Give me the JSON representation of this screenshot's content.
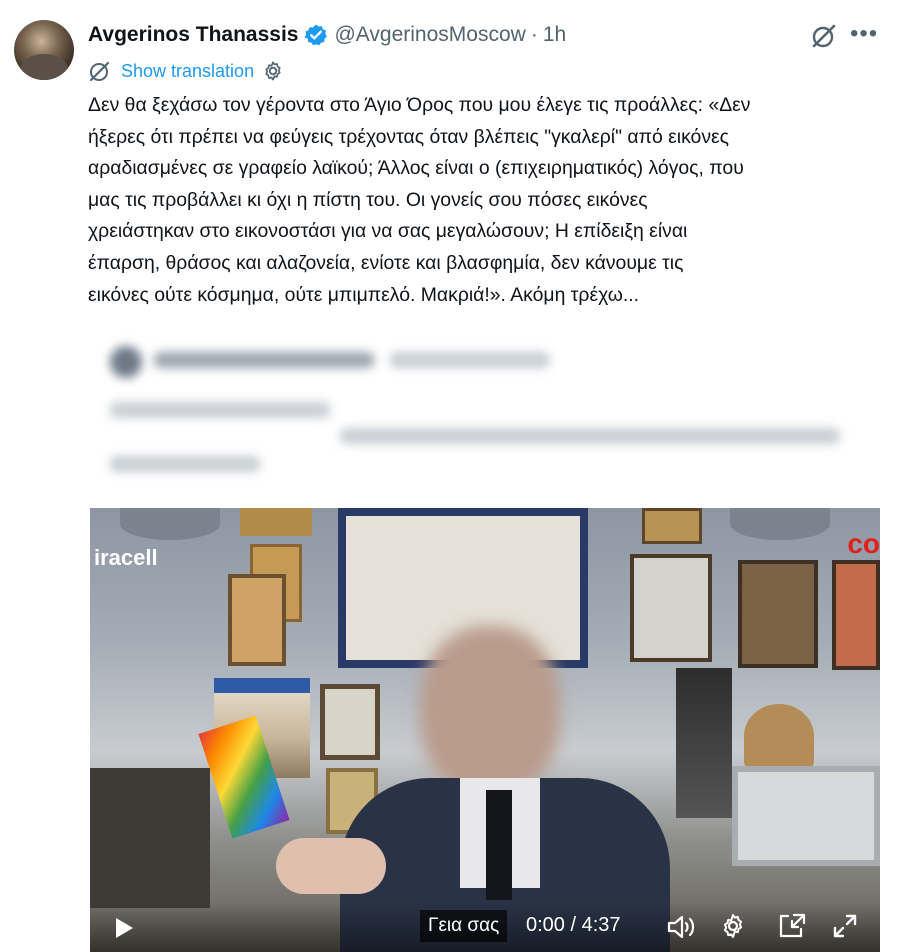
{
  "author": {
    "name": "Avgerinos Thanassis",
    "handle": "@AvgerinosMoscow",
    "separator": "·",
    "time": "1h"
  },
  "translation": {
    "label": "Show translation"
  },
  "tweet": {
    "lines": [
      "Δεν θα ξεχάσω τον γέροντα στο Άγιο Όρος που μου έλεγε τις προάλλες: «Δεν",
      "ήξερες ότι πρέπει να φεύγεις τρέχοντας όταν βλέπεις \"γκαλερί\" από εικόνες",
      "αραδιασμένες σε γραφείο λαϊκού; Άλλος είναι ο (επιχειρηματικός) λόγος, που",
      "μας τις προβάλλει κι όχι η πίστη του. Οι γονείς σου πόσες εικόνες",
      "χρειάστηκαν στο εικονοστάσι για να σας μεγαλώσουν; Η επίδειξη είναι",
      "έπαρση, θράσος και αλαζονεία, ενίοτε και βλασφημία, δεν κάνουμε τις",
      "εικόνες ούτε κόσμημα, ούτε μπιμπελό. Μακριά!». Ακόμη τρέχω..."
    ]
  },
  "video": {
    "brand_left": "iracell",
    "brand_right": "co",
    "caption": "Γεια σας",
    "timecode": "0:00 / 4:37"
  },
  "icons": {
    "verified": "verified-badge-icon",
    "grok": "grok-icon",
    "more": "more-icon",
    "translate": "translate-icon",
    "settings": "gear-icon",
    "play": "play-icon",
    "volume": "volume-icon",
    "pip": "picture-in-picture-icon",
    "fullscreen": "fullscreen-icon"
  },
  "colors": {
    "link": "#1d9bf0",
    "secondary_text": "#536471",
    "primary_text": "#0f1419"
  }
}
